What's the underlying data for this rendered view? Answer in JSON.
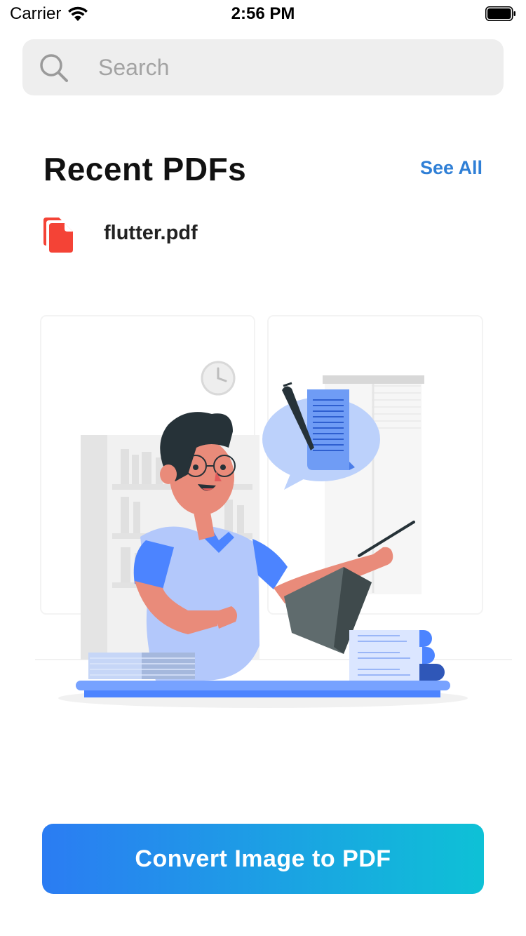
{
  "status_bar": {
    "carrier": "Carrier",
    "time": "2:56 PM"
  },
  "search": {
    "placeholder": "Search",
    "value": ""
  },
  "recent": {
    "title": "Recent PDFs",
    "see_all_label": "See All",
    "items": [
      {
        "name": "flutter.pdf",
        "icon": "pdf-file-icon"
      }
    ]
  },
  "illustration": {
    "icon": "person-reading-book-illustration"
  },
  "convert_button": {
    "label": "Convert Image to PDF"
  },
  "colors": {
    "accent_blue": "#2f7fd6",
    "pdf_red": "#f44336",
    "button_gradient_start": "#2b7cf3",
    "button_gradient_end": "#0ec1d6",
    "search_bg": "#eeeeee"
  }
}
